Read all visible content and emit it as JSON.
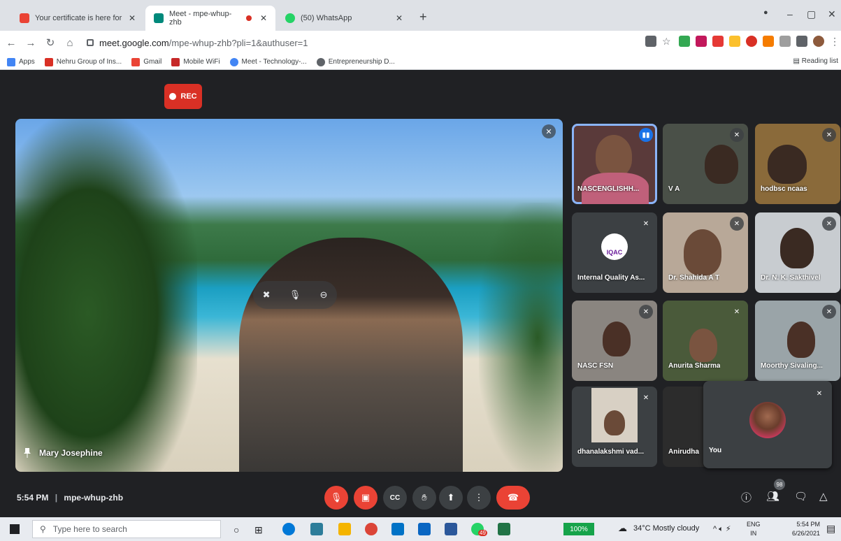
{
  "browser": {
    "tabs": [
      {
        "title": "Your certificate is here for \"Feedb",
        "active": false
      },
      {
        "title": "Meet - mpe-whup-zhb",
        "active": true
      },
      {
        "title": "(50) WhatsApp",
        "active": false
      }
    ],
    "url_host": "meet.google.com",
    "url_path": "/mpe-whup-zhb?pli=1&authuser=1",
    "bookmarks": [
      "Apps",
      "Nehru Group of Ins...",
      "Gmail",
      "Mobile WiFi",
      "Meet - Technology-...",
      "Entrepreneurship D..."
    ],
    "reading_list": "Reading list"
  },
  "meet": {
    "rec_label": "REC",
    "main_speaker": "Mary Josephine",
    "participants": [
      {
        "name": "NASCENGLISHH...",
        "speaking": true
      },
      {
        "name": "V A",
        "speaking": false
      },
      {
        "name": "hodbsc ncaas",
        "speaking": false
      },
      {
        "name": "Internal Quality As...",
        "speaking": false
      },
      {
        "name": "Dr. Shahida A T",
        "speaking": false
      },
      {
        "name": "Dr. N. K. Sakthivel",
        "speaking": false
      },
      {
        "name": "NASC FSN",
        "speaking": false
      },
      {
        "name": "Anurita Sharma",
        "speaking": false
      },
      {
        "name": "Moorthy Sivaling...",
        "speaking": false
      },
      {
        "name": "dhanalakshmi vad...",
        "speaking": false
      },
      {
        "name": "Anirudha",
        "speaking": false
      }
    ],
    "self_label": "You",
    "iqac_logo": "IQAC",
    "time": "5:54 PM",
    "separator": "|",
    "meeting_code": "mpe-whup-zhb",
    "participant_count": "98"
  },
  "taskbar": {
    "search_placeholder": "Type here to search",
    "battery": "100%",
    "weather": "34°C  Mostly cloudy",
    "lang": "ENG",
    "region": "IN",
    "time": "5:54 PM",
    "date": "6/26/2021",
    "whatsapp_badge": "49"
  }
}
